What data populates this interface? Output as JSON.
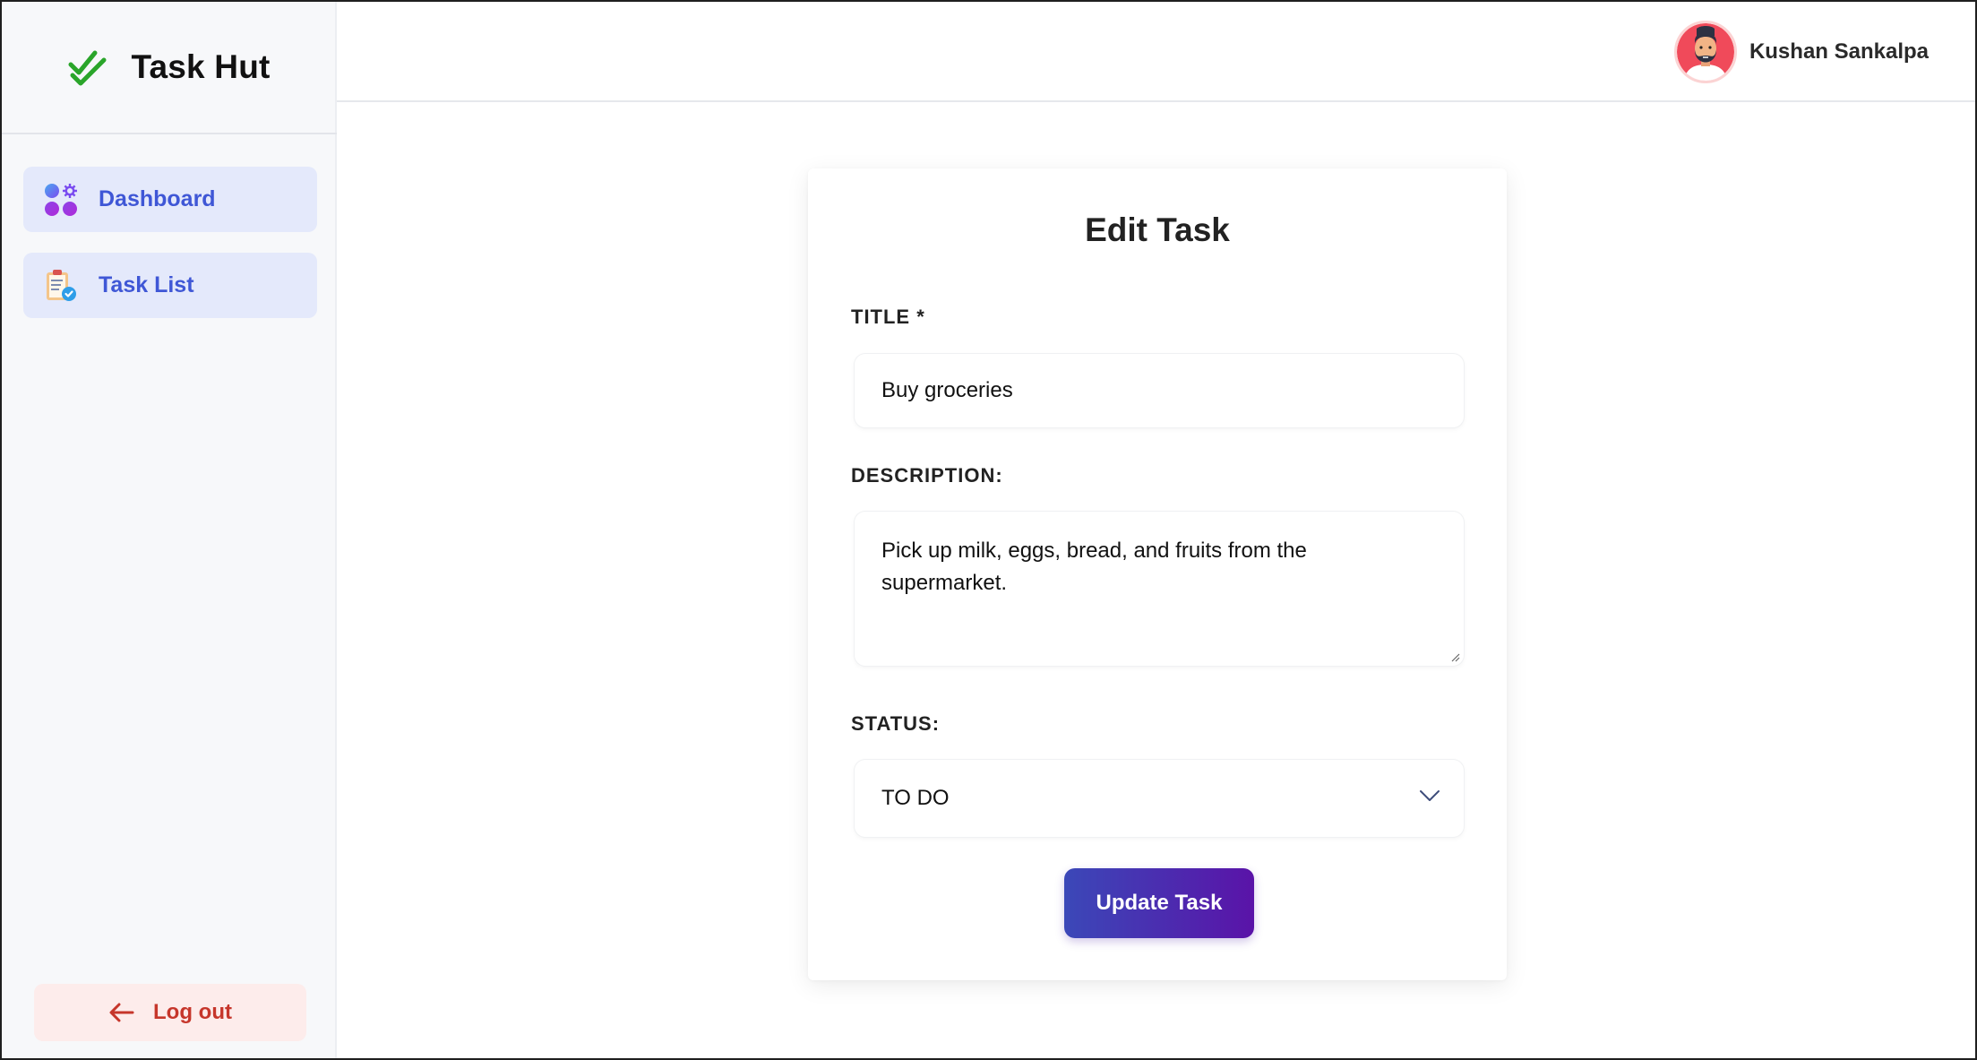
{
  "app": {
    "name": "Task Hut"
  },
  "sidebar": {
    "items": [
      {
        "label": "Dashboard",
        "icon": "dashboard-apps-icon"
      },
      {
        "label": "Task List",
        "icon": "clipboard-check-icon"
      }
    ],
    "logout_label": "Log out"
  },
  "header": {
    "user_name": "Kushan Sankalpa"
  },
  "form": {
    "title": "Edit Task",
    "title_label": "TITLE *",
    "title_value": "Buy groceries",
    "description_label": "DESCRIPTION:",
    "description_value": "Pick up milk, eggs, bread, and fruits from the supermarket.",
    "status_label": "STATUS:",
    "status_value": "TO DO",
    "submit_label": "Update Task"
  },
  "colors": {
    "brand_check": "#2aa52a",
    "nav_bg": "#e4e9fb",
    "nav_text": "#3f57d6",
    "logout_bg": "#fdeceb",
    "logout_text": "#c6362b",
    "button_gradient_start": "#3b48b8",
    "button_gradient_end": "#5a13a8"
  }
}
